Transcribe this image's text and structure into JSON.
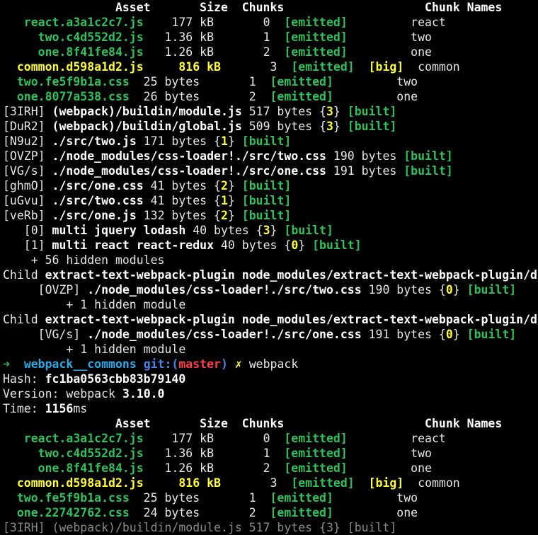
{
  "terminal": {
    "lines": [
      [
        {
          "t": "                Asset       Size  Chunks                    Chunk Names",
          "c": "white",
          "b": true
        }
      ],
      [
        {
          "t": "   react.a3a1c2c7.js",
          "c": "green",
          "b": true
        },
        {
          "t": "    177 kB       0  ",
          "c": "default"
        },
        {
          "t": "[emitted]",
          "c": "green",
          "b": true
        },
        {
          "t": "         react",
          "c": "default"
        }
      ],
      [
        {
          "t": "     two.c4d552d2.js",
          "c": "green",
          "b": true
        },
        {
          "t": "   1.36 kB       1  ",
          "c": "default"
        },
        {
          "t": "[emitted]",
          "c": "green",
          "b": true
        },
        {
          "t": "         two",
          "c": "default"
        }
      ],
      [
        {
          "t": "     one.8f41fe84.js",
          "c": "green",
          "b": true
        },
        {
          "t": "   1.26 kB       2  ",
          "c": "default"
        },
        {
          "t": "[emitted]",
          "c": "green",
          "b": true
        },
        {
          "t": "         one",
          "c": "default"
        }
      ],
      [
        {
          "t": "  common.d598a1d2.js",
          "c": "yellow",
          "b": true
        },
        {
          "t": "     816 kB",
          "c": "yellow",
          "b": true
        },
        {
          "t": "       3  ",
          "c": "default"
        },
        {
          "t": "[emitted]",
          "c": "green",
          "b": true
        },
        {
          "t": "  ",
          "c": "default"
        },
        {
          "t": "[big]",
          "c": "yellow",
          "b": true
        },
        {
          "t": "  common",
          "c": "default"
        }
      ],
      [
        {
          "t": "  two.fe5f9b1a.css",
          "c": "green",
          "b": true
        },
        {
          "t": "  25 bytes       1  ",
          "c": "default"
        },
        {
          "t": "[emitted]",
          "c": "green",
          "b": true
        },
        {
          "t": "         two",
          "c": "default"
        }
      ],
      [
        {
          "t": "  one.8077a538.css",
          "c": "green",
          "b": true
        },
        {
          "t": "  26 bytes       2  ",
          "c": "default"
        },
        {
          "t": "[emitted]",
          "c": "green",
          "b": true
        },
        {
          "t": "         one",
          "c": "default"
        }
      ],
      [
        {
          "t": "[3IRH] ",
          "c": "default"
        },
        {
          "t": "(webpack)/buildin/module.js",
          "c": "white",
          "b": true
        },
        {
          "t": " 517 bytes {",
          "c": "default"
        },
        {
          "t": "3",
          "c": "yellow",
          "b": true
        },
        {
          "t": "} ",
          "c": "default"
        },
        {
          "t": "[built]",
          "c": "green",
          "b": true
        }
      ],
      [
        {
          "t": "[DuR2] ",
          "c": "default"
        },
        {
          "t": "(webpack)/buildin/global.js",
          "c": "white",
          "b": true
        },
        {
          "t": " 509 bytes {",
          "c": "default"
        },
        {
          "t": "3",
          "c": "yellow",
          "b": true
        },
        {
          "t": "} ",
          "c": "default"
        },
        {
          "t": "[built]",
          "c": "green",
          "b": true
        }
      ],
      [
        {
          "t": "[N9u2] ",
          "c": "default"
        },
        {
          "t": "./src/two.js",
          "c": "white",
          "b": true
        },
        {
          "t": " 171 bytes {",
          "c": "default"
        },
        {
          "t": "1",
          "c": "yellow",
          "b": true
        },
        {
          "t": "} ",
          "c": "default"
        },
        {
          "t": "[built]",
          "c": "green",
          "b": true
        }
      ],
      [
        {
          "t": "[OVZP] ",
          "c": "default"
        },
        {
          "t": "./node_modules/css-loader!./src/two.css",
          "c": "white",
          "b": true
        },
        {
          "t": " 190 bytes ",
          "c": "default"
        },
        {
          "t": "[built]",
          "c": "green",
          "b": true
        }
      ],
      [
        {
          "t": "[VG/s] ",
          "c": "default"
        },
        {
          "t": "./node_modules/css-loader!./src/one.css",
          "c": "white",
          "b": true
        },
        {
          "t": " 191 bytes ",
          "c": "default"
        },
        {
          "t": "[built]",
          "c": "green",
          "b": true
        }
      ],
      [
        {
          "t": "[ghmO] ",
          "c": "default"
        },
        {
          "t": "./src/one.css",
          "c": "white",
          "b": true
        },
        {
          "t": " 41 bytes {",
          "c": "default"
        },
        {
          "t": "2",
          "c": "yellow",
          "b": true
        },
        {
          "t": "} ",
          "c": "default"
        },
        {
          "t": "[built]",
          "c": "green",
          "b": true
        }
      ],
      [
        {
          "t": "[uGvu] ",
          "c": "default"
        },
        {
          "t": "./src/two.css",
          "c": "white",
          "b": true
        },
        {
          "t": " 41 bytes {",
          "c": "default"
        },
        {
          "t": "1",
          "c": "yellow",
          "b": true
        },
        {
          "t": "} ",
          "c": "default"
        },
        {
          "t": "[built]",
          "c": "green",
          "b": true
        }
      ],
      [
        {
          "t": "[veRb] ",
          "c": "default"
        },
        {
          "t": "./src/one.js",
          "c": "white",
          "b": true
        },
        {
          "t": " 132 bytes {",
          "c": "default"
        },
        {
          "t": "2",
          "c": "yellow",
          "b": true
        },
        {
          "t": "} ",
          "c": "default"
        },
        {
          "t": "[built]",
          "c": "green",
          "b": true
        }
      ],
      [
        {
          "t": "   [0] ",
          "c": "default"
        },
        {
          "t": "multi jquery lodash",
          "c": "white",
          "b": true
        },
        {
          "t": " 40 bytes {",
          "c": "default"
        },
        {
          "t": "3",
          "c": "yellow",
          "b": true
        },
        {
          "t": "} ",
          "c": "default"
        },
        {
          "t": "[built]",
          "c": "green",
          "b": true
        }
      ],
      [
        {
          "t": "   [1] ",
          "c": "default"
        },
        {
          "t": "multi react react-redux",
          "c": "white",
          "b": true
        },
        {
          "t": " 40 bytes {",
          "c": "default"
        },
        {
          "t": "0",
          "c": "yellow",
          "b": true
        },
        {
          "t": "} ",
          "c": "default"
        },
        {
          "t": "[built]",
          "c": "green",
          "b": true
        }
      ],
      [
        {
          "t": "    + 56 hidden modules",
          "c": "default"
        }
      ],
      [
        {
          "t": "Child ",
          "c": "default"
        },
        {
          "t": "extract-text-webpack-plugin node_modules/extract-text-webpack-plugin/d",
          "c": "white",
          "b": true
        }
      ],
      [
        {
          "t": "     [OVZP] ",
          "c": "default"
        },
        {
          "t": "./node_modules/css-loader!./src/two.css",
          "c": "white",
          "b": true
        },
        {
          "t": " 190 bytes {",
          "c": "default"
        },
        {
          "t": "0",
          "c": "yellow",
          "b": true
        },
        {
          "t": "} ",
          "c": "default"
        },
        {
          "t": "[built]",
          "c": "green",
          "b": true
        }
      ],
      [
        {
          "t": "         + 1 hidden module",
          "c": "default"
        }
      ],
      [
        {
          "t": "Child ",
          "c": "default"
        },
        {
          "t": "extract-text-webpack-plugin node_modules/extract-text-webpack-plugin/d",
          "c": "white",
          "b": true
        }
      ],
      [
        {
          "t": "     [VG/s] ",
          "c": "default"
        },
        {
          "t": "./node_modules/css-loader!./src/one.css",
          "c": "white",
          "b": true
        },
        {
          "t": " 191 bytes {",
          "c": "default"
        },
        {
          "t": "0",
          "c": "yellow",
          "b": true
        },
        {
          "t": "} ",
          "c": "default"
        },
        {
          "t": "[built]",
          "c": "green",
          "b": true
        }
      ],
      [
        {
          "t": "         + 1 hidden module",
          "c": "default"
        }
      ],
      [
        {
          "t": "➜  ",
          "c": "green",
          "b": true
        },
        {
          "t": "webpack__commons",
          "c": "cyan",
          "b": true
        },
        {
          "t": " git:(",
          "c": "blue",
          "b": true
        },
        {
          "t": "master",
          "c": "red",
          "b": true
        },
        {
          "t": ")",
          "c": "blue",
          "b": true
        },
        {
          "t": " ✗ ",
          "c": "yellow",
          "b": true
        },
        {
          "t": "webpack",
          "c": "default"
        }
      ],
      [
        {
          "t": "Hash: ",
          "c": "default"
        },
        {
          "t": "fc1ba0563cbb83b79140",
          "c": "white",
          "b": true
        }
      ],
      [
        {
          "t": "Version: webpack ",
          "c": "default"
        },
        {
          "t": "3.10.0",
          "c": "white",
          "b": true
        }
      ],
      [
        {
          "t": "Time: ",
          "c": "default"
        },
        {
          "t": "1156",
          "c": "white",
          "b": true
        },
        {
          "t": "ms",
          "c": "default"
        }
      ],
      [
        {
          "t": "                Asset       Size  Chunks                    Chunk Names",
          "c": "white",
          "b": true
        }
      ],
      [
        {
          "t": "   react.a3a1c2c7.js",
          "c": "green",
          "b": true
        },
        {
          "t": "    177 kB       0  ",
          "c": "default"
        },
        {
          "t": "[emitted]",
          "c": "green",
          "b": true
        },
        {
          "t": "         react",
          "c": "default"
        }
      ],
      [
        {
          "t": "     two.c4d552d2.js",
          "c": "green",
          "b": true
        },
        {
          "t": "   1.36 kB       1  ",
          "c": "default"
        },
        {
          "t": "[emitted]",
          "c": "green",
          "b": true
        },
        {
          "t": "         two",
          "c": "default"
        }
      ],
      [
        {
          "t": "     one.8f41fe84.js",
          "c": "green",
          "b": true
        },
        {
          "t": "   1.26 kB       2  ",
          "c": "default"
        },
        {
          "t": "[emitted]",
          "c": "green",
          "b": true
        },
        {
          "t": "         one",
          "c": "default"
        }
      ],
      [
        {
          "t": "  common.d598a1d2.js",
          "c": "yellow",
          "b": true
        },
        {
          "t": "     816 kB",
          "c": "yellow",
          "b": true
        },
        {
          "t": "       3  ",
          "c": "default"
        },
        {
          "t": "[emitted]",
          "c": "green",
          "b": true
        },
        {
          "t": "  ",
          "c": "default"
        },
        {
          "t": "[big]",
          "c": "yellow",
          "b": true
        },
        {
          "t": "  common",
          "c": "default"
        }
      ],
      [
        {
          "t": "  two.fe5f9b1a.css",
          "c": "green",
          "b": true
        },
        {
          "t": "  25 bytes       1  ",
          "c": "default"
        },
        {
          "t": "[emitted]",
          "c": "green",
          "b": true
        },
        {
          "t": "         two",
          "c": "default"
        }
      ],
      [
        {
          "t": "  one.22742762.css",
          "c": "green",
          "b": true
        },
        {
          "t": "  24 bytes       2  ",
          "c": "default"
        },
        {
          "t": "[emitted]",
          "c": "green",
          "b": true
        },
        {
          "t": "         one",
          "c": "default"
        }
      ],
      [
        {
          "t": "[3IRH] (webpack)/buildin/module.js 517 bytes {3} [built]",
          "c": "dim"
        }
      ]
    ]
  }
}
